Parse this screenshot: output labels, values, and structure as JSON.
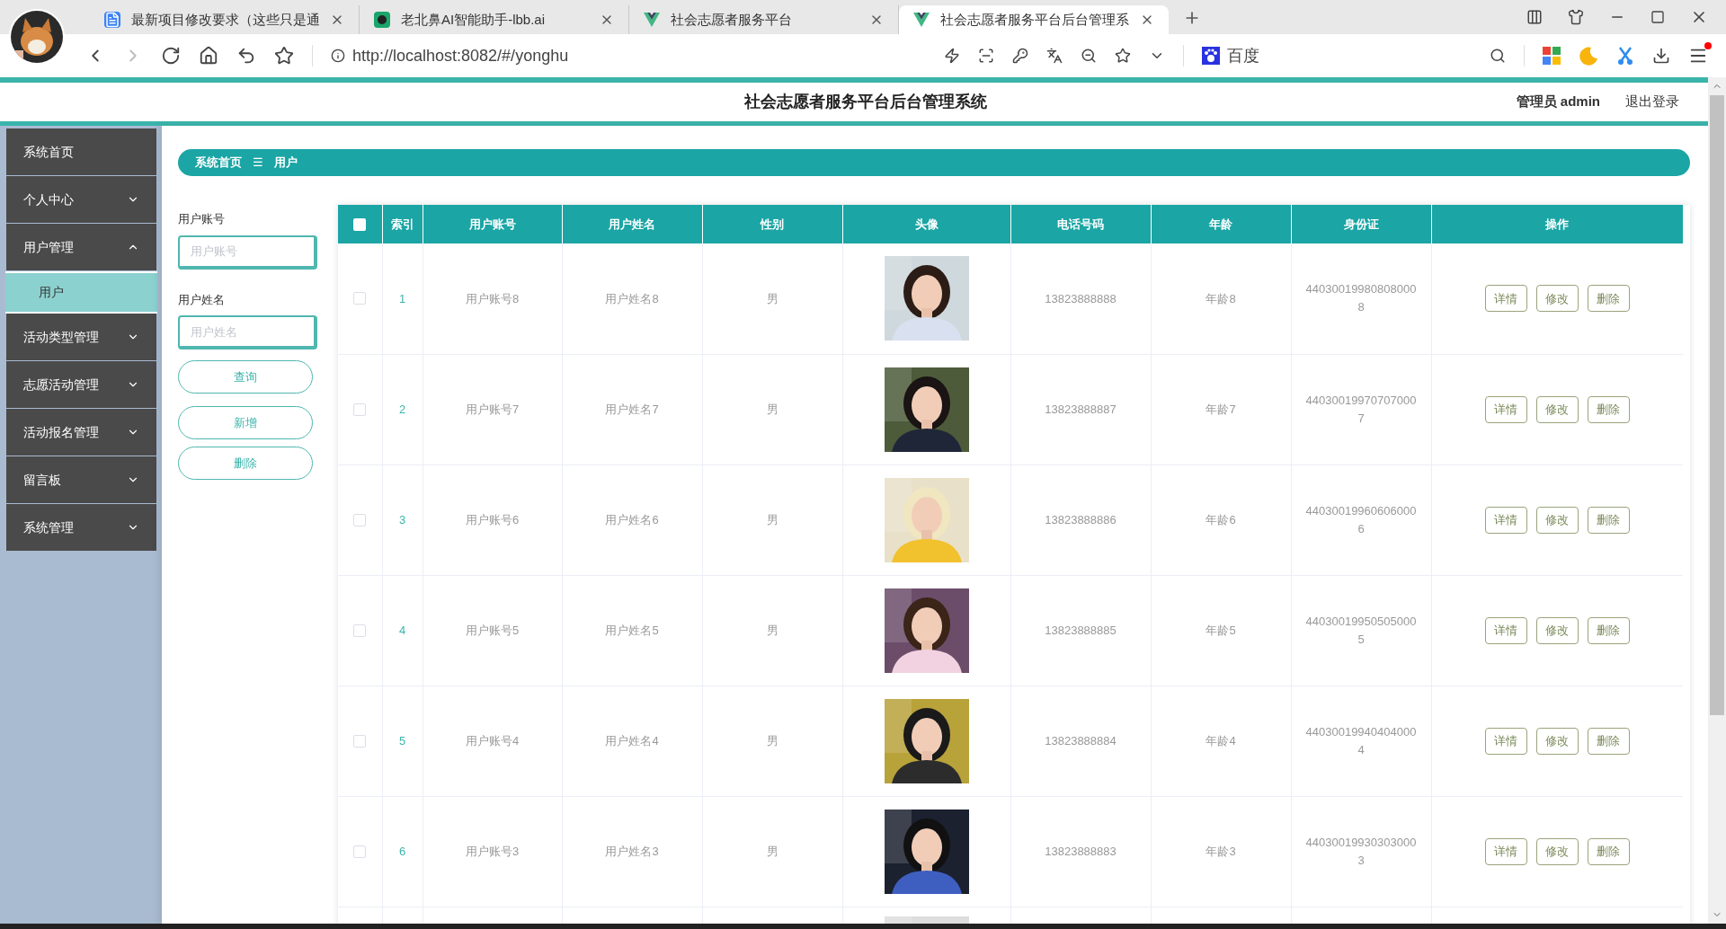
{
  "browser": {
    "tabs": [
      {
        "title": "最新项目修改要求（这些只是通",
        "selected": false,
        "kind": "doc"
      },
      {
        "title": "老北鼻AI智能助手-lbb.ai",
        "selected": false,
        "kind": "ai"
      },
      {
        "title": "社会志愿者服务平台",
        "selected": false,
        "kind": "vue"
      },
      {
        "title": "社会志愿者服务平台后台管理系",
        "selected": true,
        "kind": "vue"
      }
    ],
    "url": "http://localhost:8082/#/yonghu",
    "search_engine": "百度"
  },
  "header": {
    "title": "社会志愿者服务平台后台管理系统",
    "user": "管理员 admin",
    "logout": "退出登录"
  },
  "sidebar": {
    "items": [
      {
        "label": "系统首页",
        "expandable": false
      },
      {
        "label": "个人中心",
        "expandable": true,
        "expanded": false
      },
      {
        "label": "用户管理",
        "expandable": true,
        "expanded": true,
        "children": [
          {
            "label": "用户",
            "selected": true
          }
        ]
      },
      {
        "label": "活动类型管理",
        "expandable": true,
        "expanded": false
      },
      {
        "label": "志愿活动管理",
        "expandable": true,
        "expanded": false
      },
      {
        "label": "活动报名管理",
        "expandable": true,
        "expanded": false
      },
      {
        "label": "留言板",
        "expandable": true,
        "expanded": false
      },
      {
        "label": "系统管理",
        "expandable": true,
        "expanded": false
      }
    ]
  },
  "breadcrumb": {
    "home": "系统首页",
    "separator": "☰",
    "current": "用户"
  },
  "search": {
    "fields": [
      {
        "label": "用户账号",
        "placeholder": "用户账号"
      },
      {
        "label": "用户姓名",
        "placeholder": "用户姓名"
      }
    ],
    "buttons": [
      "查询",
      "新增",
      "删除"
    ]
  },
  "table": {
    "header_checked": false,
    "columns": [
      "索引",
      "用户账号",
      "用户姓名",
      "性别",
      "头像",
      "电话号码",
      "年龄",
      "身份证",
      "操作"
    ],
    "rows": [
      {
        "checked": false,
        "index": "1",
        "account": "用户账号8",
        "name": "用户姓名8",
        "gender": "男",
        "avatar": {
          "kind": "picture"
        },
        "phone": "13823888888",
        "age": "年龄8",
        "id_card": "440300199808080008",
        "actions": [
          "详情",
          "修改",
          "删除"
        ]
      },
      {
        "checked": false,
        "index": "2",
        "account": "用户账号7",
        "name": "用户姓名7",
        "gender": "男",
        "avatar": {
          "kind": "picture"
        },
        "phone": "13823888887",
        "age": "年龄7",
        "id_card": "440300199707070007",
        "actions": [
          "详情",
          "修改",
          "删除"
        ]
      },
      {
        "checked": false,
        "index": "3",
        "account": "用户账号6",
        "name": "用户姓名6",
        "gender": "男",
        "avatar": {
          "kind": "picture"
        },
        "phone": "13823888886",
        "age": "年龄6",
        "id_card": "440300199606060006",
        "actions": [
          "详情",
          "修改",
          "删除"
        ]
      },
      {
        "checked": false,
        "index": "4",
        "account": "用户账号5",
        "name": "用户姓名5",
        "gender": "男",
        "avatar": {
          "kind": "picture"
        },
        "phone": "13823888885",
        "age": "年龄5",
        "id_card": "440300199505050005",
        "actions": [
          "详情",
          "修改",
          "删除"
        ]
      },
      {
        "checked": false,
        "index": "5",
        "account": "用户账号4",
        "name": "用户姓名4",
        "gender": "男",
        "avatar": {
          "kind": "picture"
        },
        "phone": "13823888884",
        "age": "年龄4",
        "id_card": "440300199404040004",
        "actions": [
          "详情",
          "修改",
          "删除"
        ]
      },
      {
        "checked": false,
        "index": "6",
        "account": "用户账号3",
        "name": "用户姓名3",
        "gender": "男",
        "avatar": {
          "kind": "picture"
        },
        "phone": "13823888883",
        "age": "年龄3",
        "id_card": "440300199303030003",
        "actions": [
          "详情",
          "修改",
          "删除"
        ]
      },
      {
        "avatar": {
          "kind": "picture"
        }
      }
    ]
  }
}
